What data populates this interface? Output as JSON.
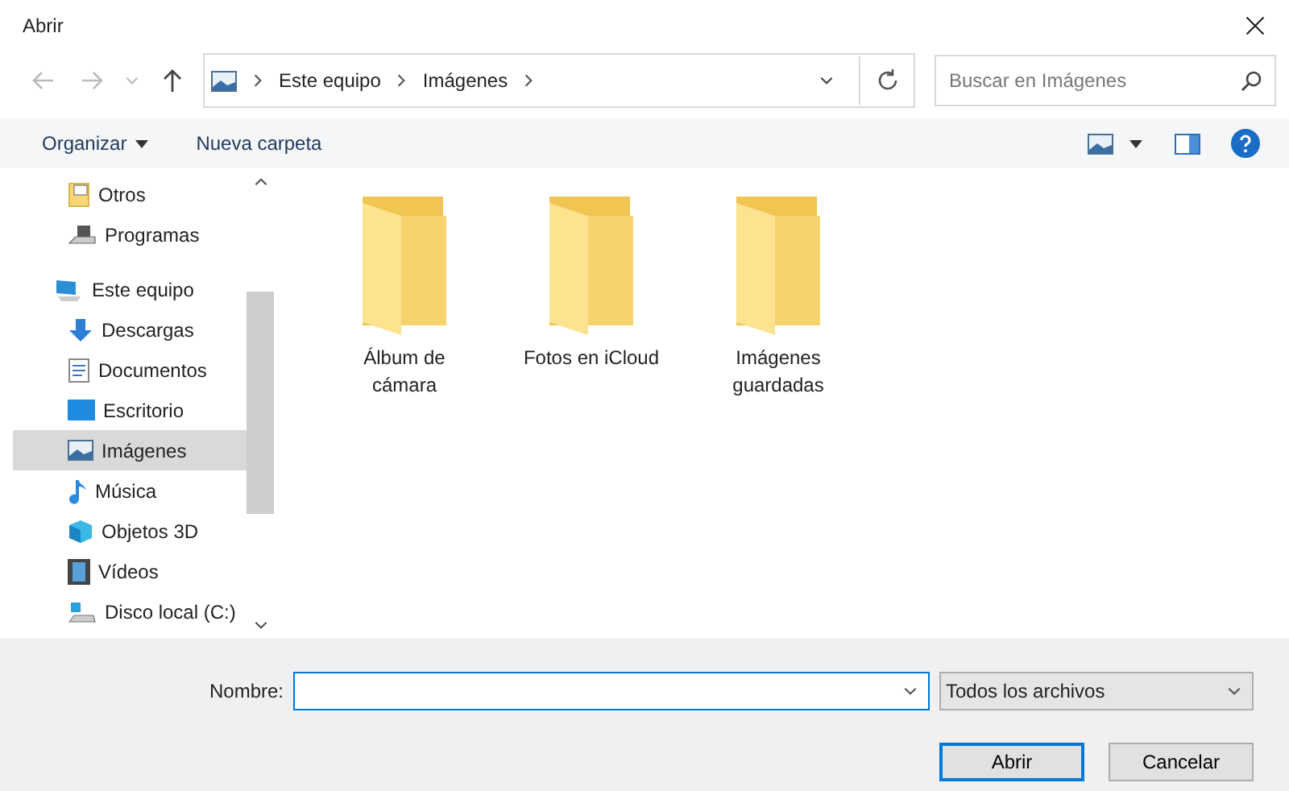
{
  "window": {
    "title": "Abrir"
  },
  "nav": {
    "breadcrumb": [
      "Este equipo",
      "Imágenes"
    ],
    "search": {
      "placeholder": "Buscar en Imágenes"
    }
  },
  "toolbar": {
    "organize": "Organizar",
    "new_folder": "Nueva carpeta"
  },
  "sidebar": {
    "items": [
      {
        "label": "Otros",
        "kind": "folder",
        "selected": false
      },
      {
        "label": "Programas",
        "kind": "programs",
        "selected": false
      },
      {
        "label": "Este equipo",
        "kind": "pc",
        "selected": false,
        "children": [
          {
            "label": "Descargas",
            "kind": "downloads",
            "selected": false
          },
          {
            "label": "Documentos",
            "kind": "documents",
            "selected": false
          },
          {
            "label": "Escritorio",
            "kind": "desktop",
            "selected": false
          },
          {
            "label": "Imágenes",
            "kind": "pictures",
            "selected": true
          },
          {
            "label": "Música",
            "kind": "music",
            "selected": false
          },
          {
            "label": "Objetos 3D",
            "kind": "objects3d",
            "selected": false
          },
          {
            "label": "Vídeos",
            "kind": "videos",
            "selected": false
          },
          {
            "label": "Disco local (C:)",
            "kind": "disk",
            "selected": false
          }
        ]
      }
    ]
  },
  "folders": [
    {
      "name": "Álbum de cámara"
    },
    {
      "name": "Fotos en iCloud"
    },
    {
      "name": "Imágenes guardadas"
    }
  ],
  "footer": {
    "name_label": "Nombre:",
    "filter": "Todos los archivos",
    "open": "Abrir",
    "cancel": "Cancelar"
  }
}
